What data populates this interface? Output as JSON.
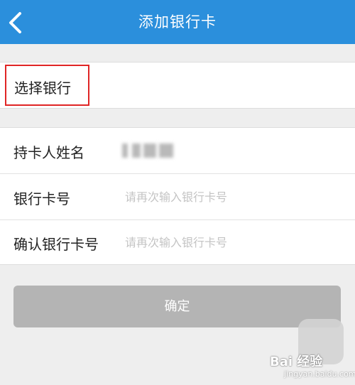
{
  "header": {
    "title": "添加银行卡",
    "back_icon": "chevron-left-icon",
    "background_color": "#2b8fdc"
  },
  "bank_section": {
    "select_bank_label": "选择银行",
    "highlight_color": "#e02525"
  },
  "form": {
    "cardholder": {
      "label": "持卡人姓名",
      "value_state": "blurred"
    },
    "card_number": {
      "label": "银行卡号",
      "placeholder": "请再次输入银行卡号"
    },
    "confirm_card_number": {
      "label": "确认银行卡号",
      "placeholder": "请再次输入银行卡号"
    }
  },
  "confirm_button": {
    "label": "确定",
    "state": "disabled",
    "color": "#b4b4b4"
  },
  "watermark": {
    "text": "Bai 经验",
    "url": "jingyan.baidu.com"
  }
}
